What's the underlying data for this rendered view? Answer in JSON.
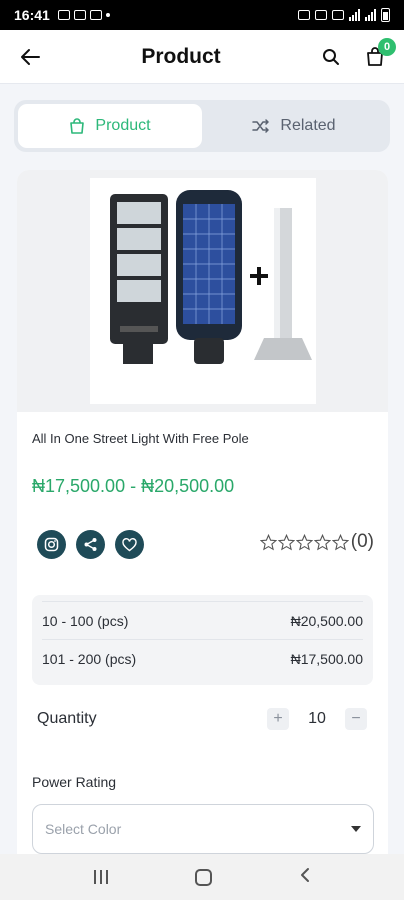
{
  "status_bar": {
    "time": "16:41"
  },
  "header": {
    "title": "Product",
    "cart_count": "0"
  },
  "tabs": [
    {
      "label": "Product",
      "icon": "shopping-bag-icon",
      "active": true
    },
    {
      "label": "Related",
      "icon": "shuffle-icon",
      "active": false
    }
  ],
  "product": {
    "name": "All In One Street Light With Free Pole",
    "price": "₦17,500.00 - ₦20,500.00",
    "rating_count": "(0)",
    "stars": 0
  },
  "share": [
    "instagram-icon",
    "share-icon",
    "heart-icon"
  ],
  "price_tiers": [
    {
      "range": "10 - 100 (pcs)",
      "price": "₦20,500.00"
    },
    {
      "range": "101 - 200 (pcs)",
      "price": "₦17,500.00"
    }
  ],
  "quantity": {
    "label": "Quantity",
    "value": "10"
  },
  "power_rating": {
    "label": "Power Rating",
    "placeholder": "Select Color"
  },
  "colors": {
    "accent": "#2db87a",
    "price": "#2aa86a",
    "circle_button": "#1f4b58"
  }
}
